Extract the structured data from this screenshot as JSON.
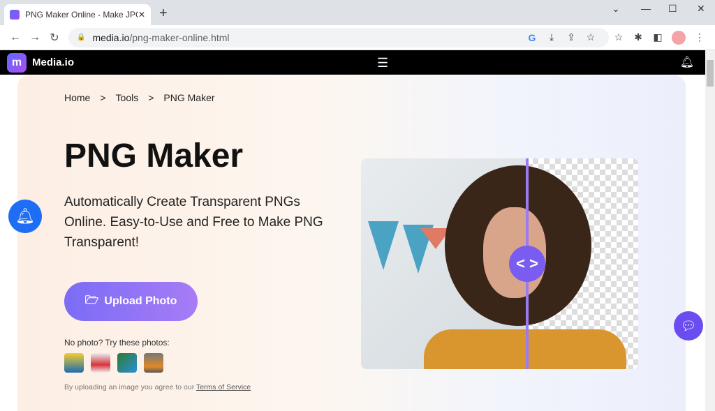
{
  "browser": {
    "tab_title": "PNG Maker Online - Make JPG",
    "url_domain": "media.io",
    "url_path": "/png-maker-online.html"
  },
  "site": {
    "brand": "Media.io",
    "logo_letter": "m"
  },
  "breadcrumb": [
    "Home",
    ">",
    "Tools",
    ">",
    "PNG Maker"
  ],
  "hero": {
    "title": "PNG Maker",
    "subtitle": "Automatically Create Transparent PNGs Online. Easy-to-Use and Free to Make PNG Transparent!",
    "upload_label": "Upload Photo",
    "try_label": "No photo? Try these photos:",
    "agree_text": "By uploading an image you agree to our ",
    "terms_link": "Terms of Service"
  },
  "colors": {
    "accent": "#7b6cf6",
    "nav_bg": "#000000",
    "notif": "#1e6ef5"
  }
}
